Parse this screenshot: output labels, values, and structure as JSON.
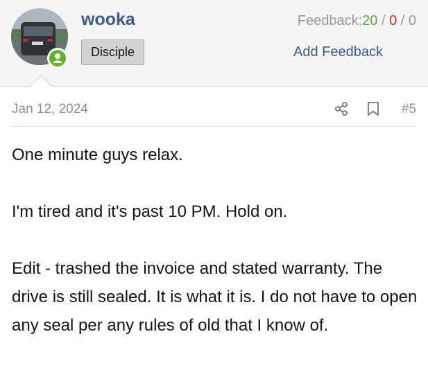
{
  "user": {
    "name": "wooka",
    "title_badge": "Disciple"
  },
  "feedback": {
    "label": "Feedback:",
    "positive": "20",
    "negative": "0",
    "neutral": "0",
    "separator": " / ",
    "add_label": "Add Feedback"
  },
  "post": {
    "date": "Jan 12, 2024",
    "number": "#5",
    "paragraphs": [
      "One minute guys relax.",
      "I'm tired and it's past 10 PM. Hold on.",
      "Edit - trashed the invoice and stated warranty. The drive is still sealed. It is what it is. I do not have to open any seal per any rules of old that I know of."
    ]
  },
  "icons": {
    "share": "share-icon",
    "bookmark": "bookmark-icon",
    "online": "online-status-icon"
  },
  "colors": {
    "username": "#3c5a8c",
    "positive": "#63a644",
    "negative": "#d62c1a",
    "online": "#63b22c"
  }
}
